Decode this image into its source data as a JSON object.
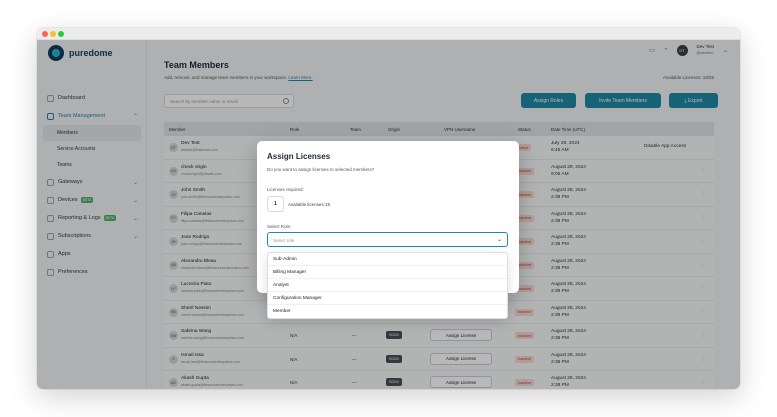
{
  "window": {
    "dots": [
      "#ff5f57",
      "#febc2e",
      "#28c840"
    ]
  },
  "brand": {
    "name": "puredome"
  },
  "sidebar": {
    "dashboard": "Dashboard",
    "team_management": "Team Management",
    "members": "Members",
    "service_accounts": "Service Accounts",
    "teams": "Teams",
    "gateways": "Gateways",
    "devices": "Devices",
    "devices_badge": "BETA",
    "reporting": "Reporting & Logs",
    "reporting_badge": "BETA",
    "subscriptions": "Subscriptions",
    "apps": "Apps",
    "preferences": "Preferences"
  },
  "header": {
    "user_name": "Dev Test",
    "user_sub": "@devtest",
    "avatar": "DT"
  },
  "page": {
    "title": "Team Members",
    "subtitle": "Add, remove, and manage team members in your workspace.",
    "learn_more": "Learn More.",
    "available_licenses": "Available Licenses: 19/25",
    "search_placeholder": "Search by member name or email",
    "assign_roles": "Assign Roles",
    "invite": "Invite Team Members",
    "export": "Export"
  },
  "table": {
    "headers": [
      "Member",
      "Role",
      "Team",
      "Origin",
      "VPN Username",
      "Status",
      "Date Time (UTC)"
    ],
    "rows": [
      {
        "initials": "DT",
        "name": "Dev Test",
        "email": "testdev@finsecure.com",
        "role": "",
        "team": "",
        "origin": "",
        "assign": "",
        "status": "Active",
        "date": "July 29, 2024",
        "time": "6:45 AM",
        "action": "Disable App Access"
      },
      {
        "initials": "CO",
        "name": "check origin",
        "email": "checkorigin@yltmails.com",
        "role": "",
        "team": "",
        "origin": "",
        "assign": "",
        "status": "Inactive",
        "date": "August 29, 2024",
        "time": "9:05 AM",
        "action": "⋮"
      },
      {
        "initials": "JS",
        "name": "John Smith",
        "email": "john.smith@finsecureenterprises.com",
        "role": "",
        "team": "",
        "origin": "",
        "assign": "",
        "status": "Inactive",
        "date": "August 28, 2024",
        "time": "2:38 PM",
        "action": "⋮"
      },
      {
        "initials": "FC",
        "name": "Filipa Canelas",
        "email": "filipa.canelas@finsecureenterprises.com",
        "role": "",
        "team": "",
        "origin": "",
        "assign": "",
        "status": "Inactive",
        "date": "August 28, 2024",
        "time": "2:38 PM",
        "action": "⋮"
      },
      {
        "initials": "JR",
        "name": "Jose Rodrigo",
        "email": "jose.rodrigo@finsecureenterprises.com",
        "role": "",
        "team": "",
        "origin": "",
        "assign": "",
        "status": "Inactive",
        "date": "August 28, 2024",
        "time": "2:38 PM",
        "action": "⋮"
      },
      {
        "initials": "AB",
        "name": "Alexandru Bleau",
        "email": "alexandru.bleau@finsecureenterprises.com",
        "role": "",
        "team": "",
        "origin": "",
        "assign": "",
        "status": "Inactive",
        "date": "August 28, 2024",
        "time": "2:38 PM",
        "action": "⋮"
      },
      {
        "initials": "LP",
        "name": "Lucrezia Piato",
        "email": "lucrezia.piato@finsecureenterprises.com",
        "role": "",
        "team": "",
        "origin": "",
        "assign": "",
        "status": "Inactive",
        "date": "August 28, 2024",
        "time": "2:38 PM",
        "action": "⋮"
      },
      {
        "initials": "SN",
        "name": "Sherif Nessim",
        "email": "sherif.nessim@finsecureenterprises.com",
        "role": "",
        "team": "",
        "origin": "",
        "assign": "",
        "status": "Inactive",
        "date": "August 28, 2024",
        "time": "2:38 PM",
        "action": "⋮"
      },
      {
        "initials": "SW",
        "name": "Sabrina Wang",
        "email": "sabrina.wang@finsecureenterprises.com",
        "role": "N/A",
        "team": "—",
        "origin": "SCIM",
        "assign": "Assign License",
        "status": "Inactive",
        "date": "August 28, 2024",
        "time": "2:38 PM",
        "action": "⋮"
      },
      {
        "initials": "II",
        "name": "Ismail Issa",
        "email": "ismail.issa@finsecureenterprises.com",
        "role": "N/A",
        "team": "—",
        "origin": "SCIM",
        "assign": "Assign License",
        "status": "Inactive",
        "date": "August 28, 2024",
        "time": "2:38 PM",
        "action": "⋮"
      },
      {
        "initials": "AG",
        "name": "Akash Gupta",
        "email": "akash.gupta@finsecureenterprises.com",
        "role": "N/A",
        "team": "—",
        "origin": "SCIM",
        "assign": "Assign License",
        "status": "Inactive",
        "date": "August 28, 2024",
        "time": "2:38 PM",
        "action": "⋮"
      }
    ]
  },
  "modal": {
    "title": "Assign Licenses",
    "description": "Do you want to assign licenses to selected members?",
    "licenses_label": "Licenses required:",
    "licenses_count": "1",
    "available": "Available licenses:19",
    "select_label": "Select Role:",
    "select_placeholder": "Select role",
    "options": [
      "Sub-Admin",
      "Billing Manager",
      "Analyst",
      "Configuration Manager",
      "Member"
    ]
  }
}
